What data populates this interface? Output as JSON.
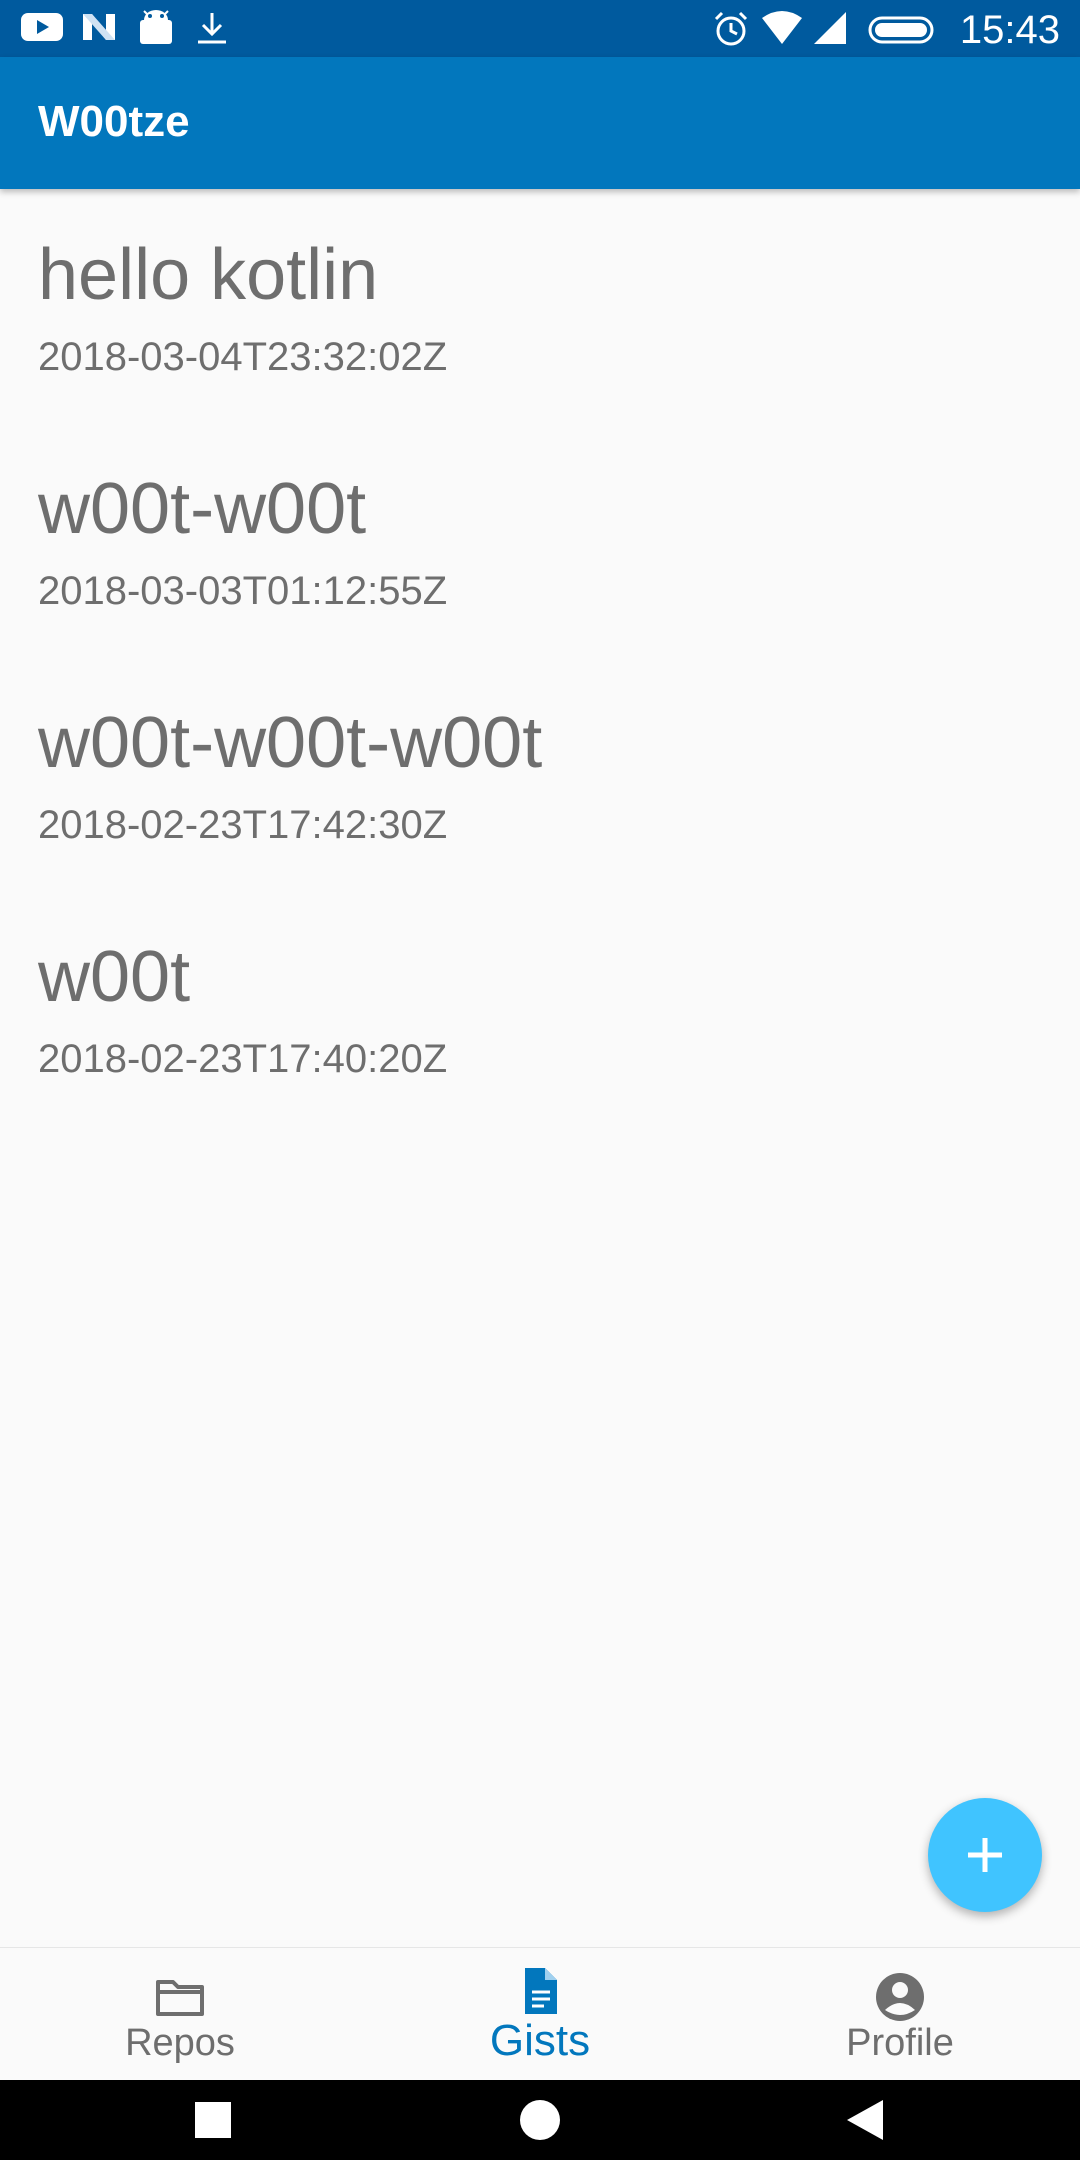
{
  "status_bar": {
    "time": "15:43",
    "left_icons": [
      "youtube-icon",
      "n-icon",
      "android-icon",
      "download-icon"
    ],
    "right_icons": [
      "alarm-icon",
      "wifi-icon",
      "signal-icon",
      "battery-icon"
    ]
  },
  "app_bar": {
    "title": "W00tze"
  },
  "gists": [
    {
      "title": "hello kotlin",
      "date": "2018-03-04T23:32:02Z"
    },
    {
      "title": "w00t-w00t",
      "date": "2018-03-03T01:12:55Z"
    },
    {
      "title": "w00t-w00t-w00t",
      "date": "2018-02-23T17:42:30Z"
    },
    {
      "title": "w00t",
      "date": "2018-02-23T17:40:20Z"
    }
  ],
  "fab": {
    "icon": "plus-icon"
  },
  "bottom_nav": {
    "items": [
      {
        "label": "Repos",
        "icon": "folder-icon",
        "active": false
      },
      {
        "label": "Gists",
        "icon": "document-icon",
        "active": true
      },
      {
        "label": "Profile",
        "icon": "account-icon",
        "active": false
      }
    ]
  },
  "system_nav": {
    "buttons": [
      "recents-button",
      "home-button",
      "back-button"
    ]
  },
  "colors": {
    "status_bar": "#005a9e",
    "app_bar": "#0277bd",
    "fab": "#40c4ff",
    "active_nav": "#0277bd",
    "inactive_text": "#6e6e6e"
  }
}
